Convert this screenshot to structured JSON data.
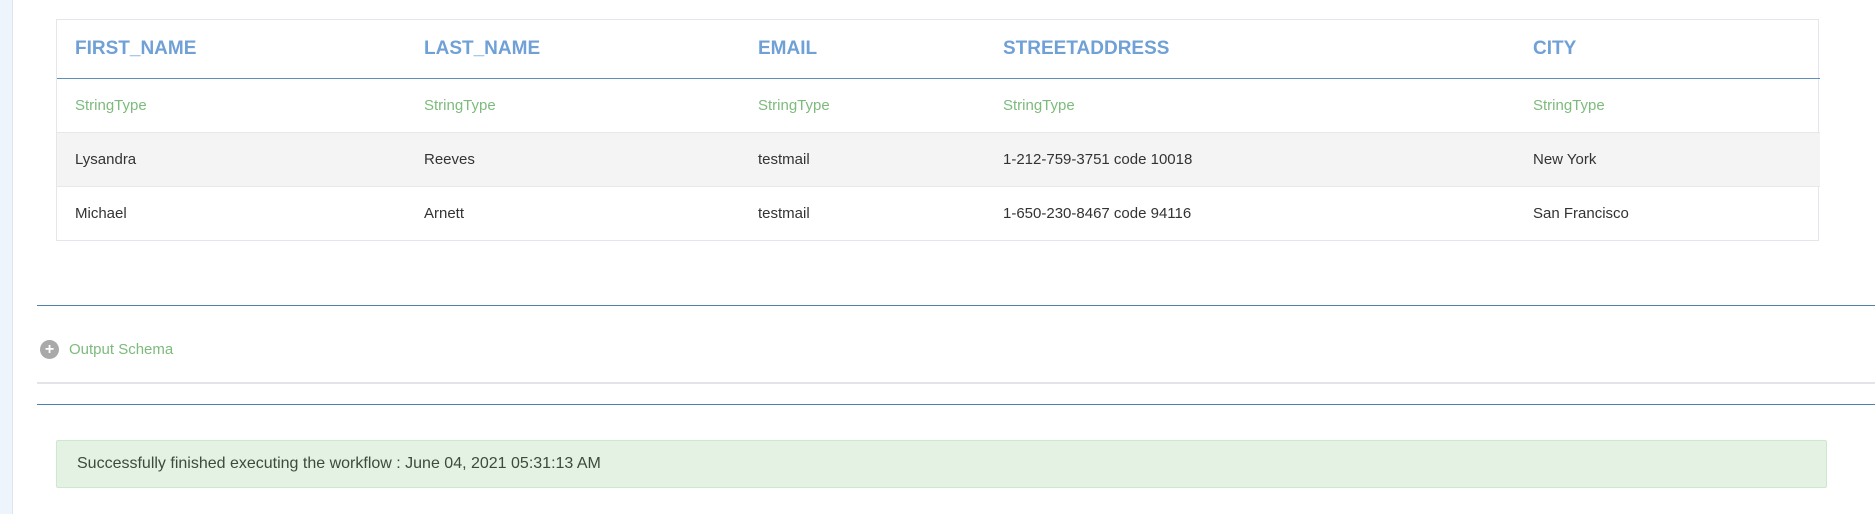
{
  "table": {
    "columns": [
      "FIRST_NAME",
      "LAST_NAME",
      "EMAIL",
      "STREETADDRESS",
      "CITY"
    ],
    "types": [
      "StringType",
      "StringType",
      "StringType",
      "StringType",
      "StringType"
    ],
    "rows": [
      [
        "Lysandra",
        "Reeves",
        "testmail",
        "1-212-759-3751 code 10018",
        "New York"
      ],
      [
        "Michael",
        "Arnett",
        "testmail",
        "1-650-230-8467 code 94116",
        "San Francisco"
      ]
    ]
  },
  "output_schema": {
    "label": "Output Schema",
    "icon": "plus-circle-icon"
  },
  "status": {
    "message": "Successfully finished executing the workflow : June 04, 2021 05:31:13 AM"
  },
  "colors": {
    "header_text": "#6fa0d6",
    "type_text": "#7dbb7d",
    "status_bg": "#e3f2e3",
    "divider": "#4f81ad"
  }
}
